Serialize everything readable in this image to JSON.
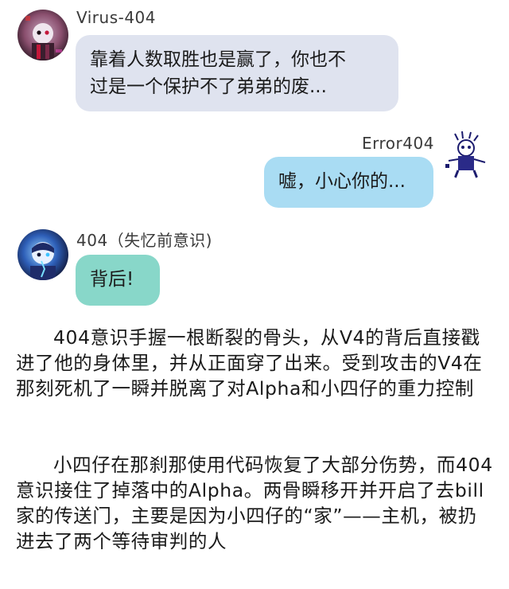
{
  "messages": [
    {
      "sender": "Virus-404",
      "text": "靠着人数取胜也是赢了，你也不\n过是一个保护不了弟弟的废...",
      "side": "left",
      "bubble_color": "#dfe3ef"
    },
    {
      "sender": "Error404",
      "text": "嘘，小心你的...",
      "side": "right",
      "bubble_color": "#a9dcf3"
    },
    {
      "sender": "404（失忆前意识)",
      "text": "背后!",
      "side": "left",
      "bubble_color": "#88d7c9"
    }
  ],
  "narration": [
    "404意识手握一根断裂的骨头，从V4的背后直接戳进了他的身体里，并从正面穿了出来。受到攻击的V4在那刻死机了一瞬并脱离了对Alpha和小四仔的重力控制",
    "小四仔在那刹那使用代码恢复了大部分伤势，而404意识接住了掉落中的Alpha。两骨瞬移开并开启了去bill家的传送门，主要是因为小四仔的“家”——主机，被扔进去了两个等待审判的人"
  ]
}
